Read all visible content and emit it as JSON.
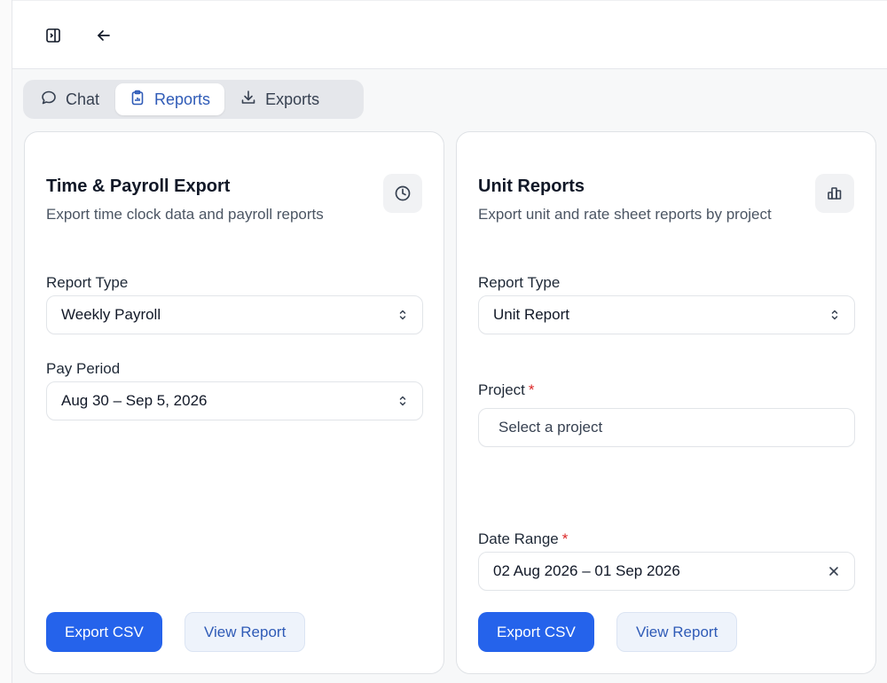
{
  "header": {
    "toggle_icon": "sidebar-toggle-icon",
    "back_icon": "arrow-left-icon"
  },
  "tabs": [
    {
      "label": "Chat",
      "icon": "chat-bubble-icon",
      "active": false
    },
    {
      "label": "Reports",
      "icon": "clipboard-icon",
      "active": true
    },
    {
      "label": "Exports",
      "icon": "download-icon",
      "active": false
    }
  ],
  "payroll_card": {
    "title": "Time & Payroll Export",
    "subtitle": "Export time clock data and payroll reports",
    "icon": "clock-icon",
    "report_type_label": "Report Type",
    "report_type_value": "Weekly Payroll",
    "pay_period_label": "Pay Period",
    "pay_period_value": "Aug 30 – Sep 5, 2026",
    "export_label": "Export CSV",
    "view_label": "View Report"
  },
  "unit_card": {
    "title": "Unit Reports",
    "subtitle": "Export unit and rate sheet reports by project",
    "icon": "bar-chart-icon",
    "report_type_label": "Report Type",
    "report_type_value": "Unit Report",
    "project_label": "Project",
    "project_required": "*",
    "project_placeholder": "Select a project",
    "date_range_label": "Date Range",
    "date_range_required": "*",
    "date_range_value": "02 Aug 2026 – 01 Sep 2026",
    "export_label": "Export CSV",
    "view_label": "View Report"
  },
  "colors": {
    "primary": "#2563eb",
    "active_tab_text": "#2f5bb7",
    "required": "#dc2626"
  }
}
